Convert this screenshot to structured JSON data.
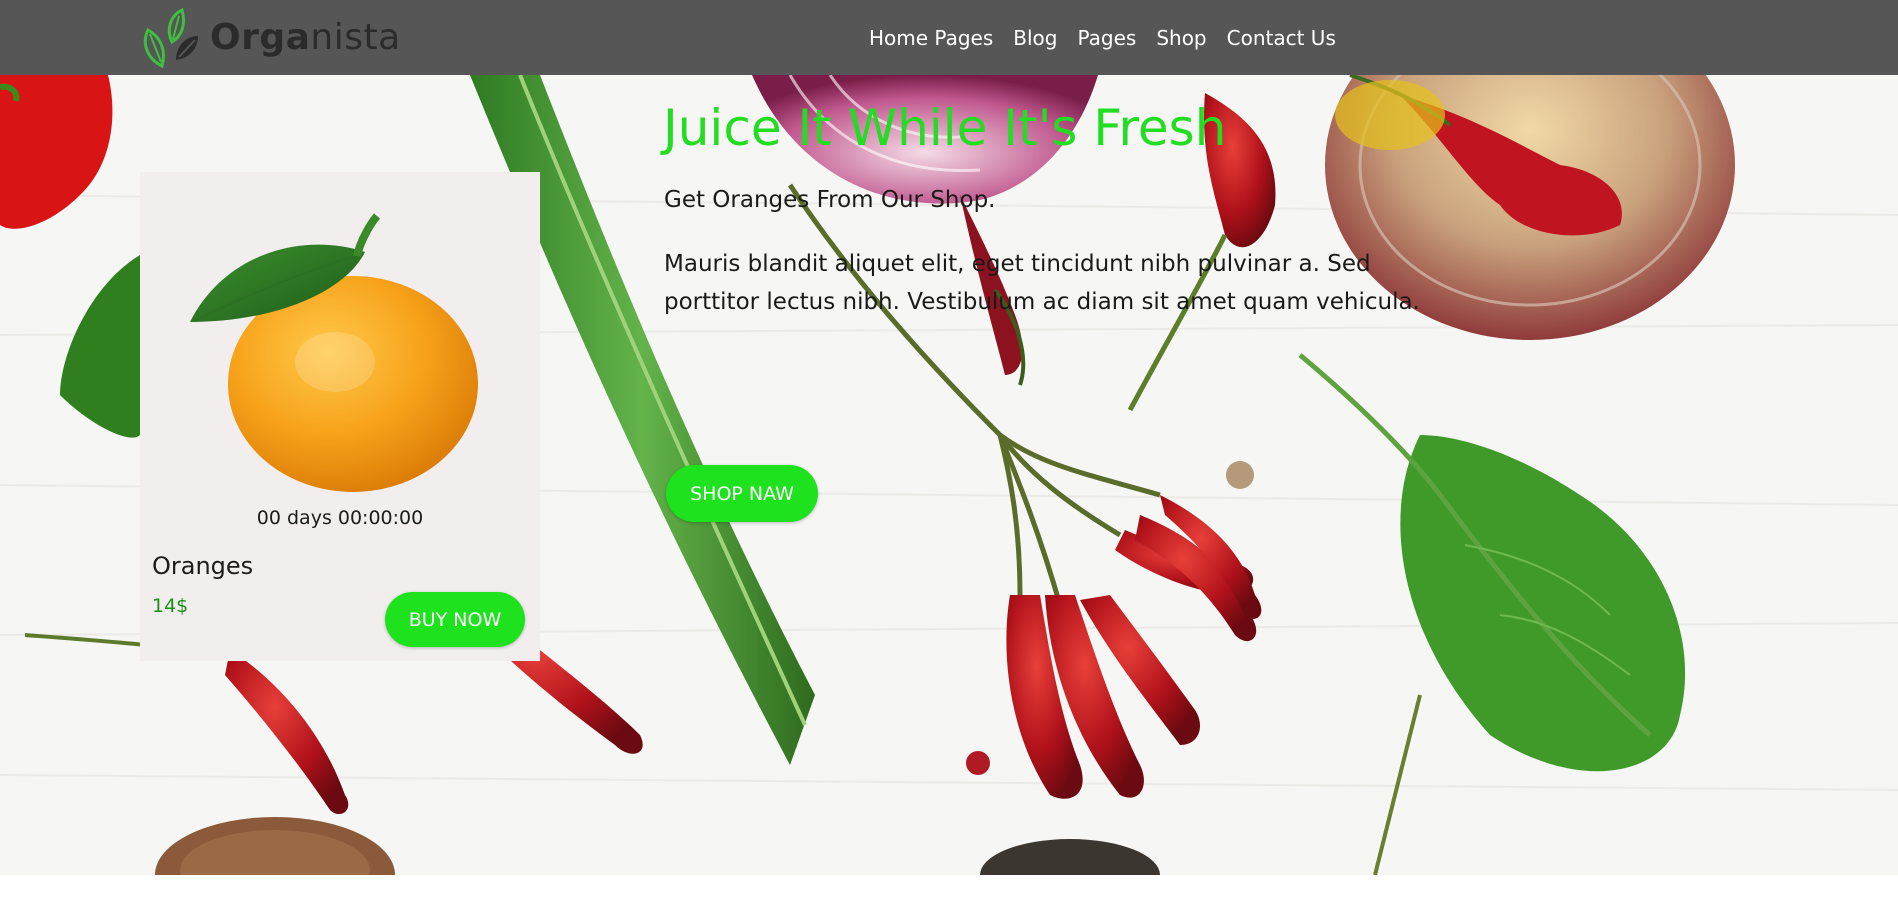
{
  "header": {
    "logo_strong": "Orga",
    "logo_light": "nista",
    "nav": [
      {
        "label": "Home Pages"
      },
      {
        "label": "Blog"
      },
      {
        "label": "Pages"
      },
      {
        "label": "Shop"
      },
      {
        "label": "Contact Us"
      }
    ]
  },
  "product_card": {
    "countdown": "00 days 00:00:00",
    "name": "Oranges",
    "price": "14$",
    "buy_label": "BUY NOW"
  },
  "hero": {
    "title": "Juice It While It's Fresh",
    "subtitle": "Get Oranges From Our Shop.",
    "text": "Mauris blandit aliquet elit, eget tincidunt nibh pulvinar a. Sed porttitor lectus nibh. Vestibulum ac diam sit amet quam vehicula.",
    "button_label": "SHOP NAW"
  },
  "colors": {
    "header_bg": "#565656",
    "accent_green": "#1fe21f",
    "title_green": "#22dd22",
    "price_green": "#1a8f1a",
    "card_bg": "#f2eeee"
  },
  "icons": {
    "logo": "leaf-logo-icon",
    "product_image": "orange-fruit-image"
  }
}
